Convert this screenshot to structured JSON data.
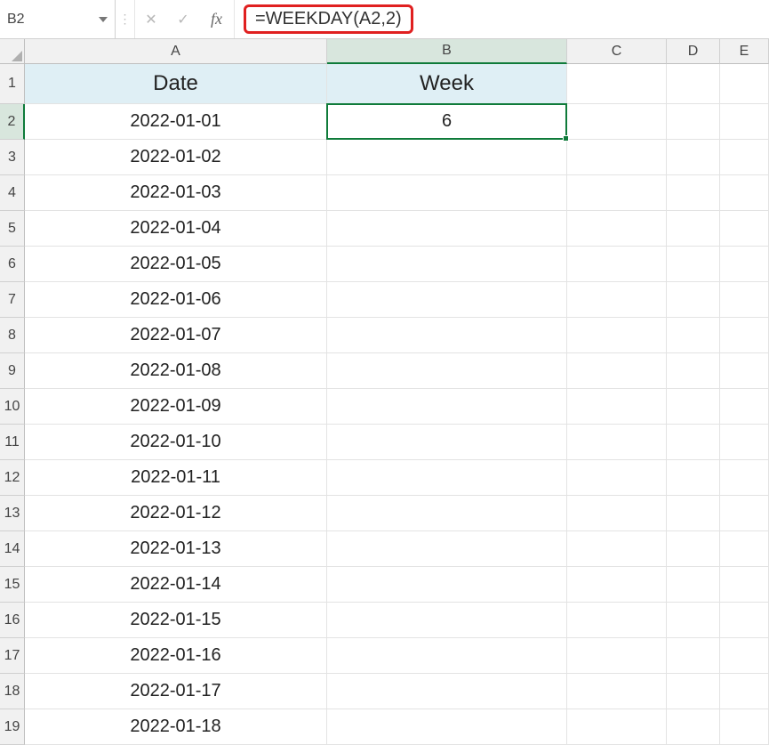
{
  "formula_bar": {
    "name_box": "B2",
    "cancel_glyph": "✕",
    "accept_glyph": "✓",
    "fx_label": "fx",
    "formula": "=WEEKDAY(A2,2)"
  },
  "columns": [
    "A",
    "B",
    "C",
    "D",
    "E"
  ],
  "selected_col_index": 1,
  "row_numbers": [
    "1",
    "2",
    "3",
    "4",
    "5",
    "6",
    "7",
    "8",
    "9",
    "10",
    "11",
    "12",
    "13",
    "14",
    "15",
    "16",
    "17",
    "18",
    "19"
  ],
  "selected_row_index": 1,
  "headers": {
    "A": "Date",
    "B": "Week"
  },
  "active_cell": {
    "ref": "B2",
    "value": "6"
  },
  "dates": [
    "2022-01-01",
    "2022-01-02",
    "2022-01-03",
    "2022-01-04",
    "2022-01-05",
    "2022-01-06",
    "2022-01-07",
    "2022-01-08",
    "2022-01-09",
    "2022-01-10",
    "2022-01-11",
    "2022-01-12",
    "2022-01-13",
    "2022-01-14",
    "2022-01-15",
    "2022-01-16",
    "2022-01-17",
    "2022-01-18"
  ]
}
